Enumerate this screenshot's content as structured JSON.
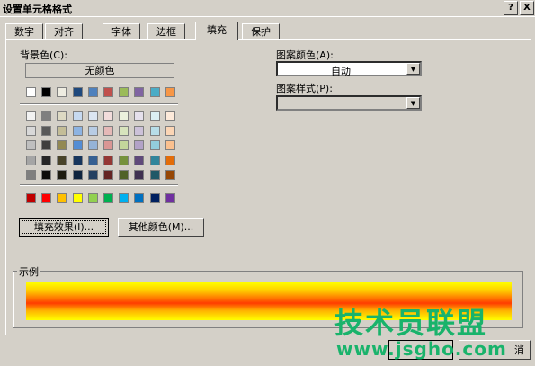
{
  "window": {
    "title": "设置单元格格式",
    "help_label": "?",
    "close_label": "X"
  },
  "tabs": [
    {
      "label": "数字"
    },
    {
      "label": "对齐"
    },
    {
      "label": "字体"
    },
    {
      "label": "边框"
    },
    {
      "label": "填充"
    },
    {
      "label": "保护"
    }
  ],
  "fill": {
    "background_label": "背景色(C):",
    "no_color_label": "无颜色",
    "fill_effects_label": "填充效果(I)...",
    "more_colors_label": "其他颜色(M)...",
    "pattern_color_label": "图案颜色(A):",
    "pattern_color_value": "自动",
    "pattern_style_label": "图案样式(P):",
    "pattern_style_value": "",
    "sample_label": "示例"
  },
  "palette": {
    "row1": [
      "#ffffff",
      "#000000",
      "#eeece1",
      "#1f497d",
      "#4f81bd",
      "#c0504d",
      "#9bbb59",
      "#8064a2",
      "#4bacc6",
      "#f79646"
    ],
    "theme": [
      [
        "#f2f2f2",
        "#7f7f7f",
        "#ddd9c3",
        "#c6d9f0",
        "#dbe5f1",
        "#f2dcdb",
        "#ebf1dd",
        "#e5e0ec",
        "#dbeef3",
        "#fdeada"
      ],
      [
        "#d8d8d8",
        "#595959",
        "#c4bd97",
        "#8db3e2",
        "#b8cce4",
        "#e5b9b7",
        "#d7e3bc",
        "#ccc1d9",
        "#b7dde8",
        "#fbd5b5"
      ],
      [
        "#bfbfbf",
        "#3f3f3f",
        "#938953",
        "#548dd4",
        "#95b3d7",
        "#d99694",
        "#c3d69b",
        "#b2a2c7",
        "#92cddc",
        "#fac08f"
      ],
      [
        "#a5a5a5",
        "#262626",
        "#494429",
        "#17365d",
        "#366092",
        "#953734",
        "#76923c",
        "#5f497a",
        "#31859b",
        "#e36c09"
      ],
      [
        "#7f7f7f",
        "#0c0c0c",
        "#1d1b10",
        "#0f243e",
        "#244061",
        "#632423",
        "#4f6128",
        "#3f3151",
        "#205867",
        "#974806"
      ]
    ],
    "standard": [
      "#c00000",
      "#ff0000",
      "#ffc000",
      "#ffff00",
      "#92d050",
      "#00b050",
      "#00b0f0",
      "#0070c0",
      "#002060",
      "#7030a0"
    ]
  },
  "footer": {
    "cancel_label": "消"
  },
  "watermark": {
    "line1": "技术员联盟",
    "line2": "www.jsgho.com"
  }
}
